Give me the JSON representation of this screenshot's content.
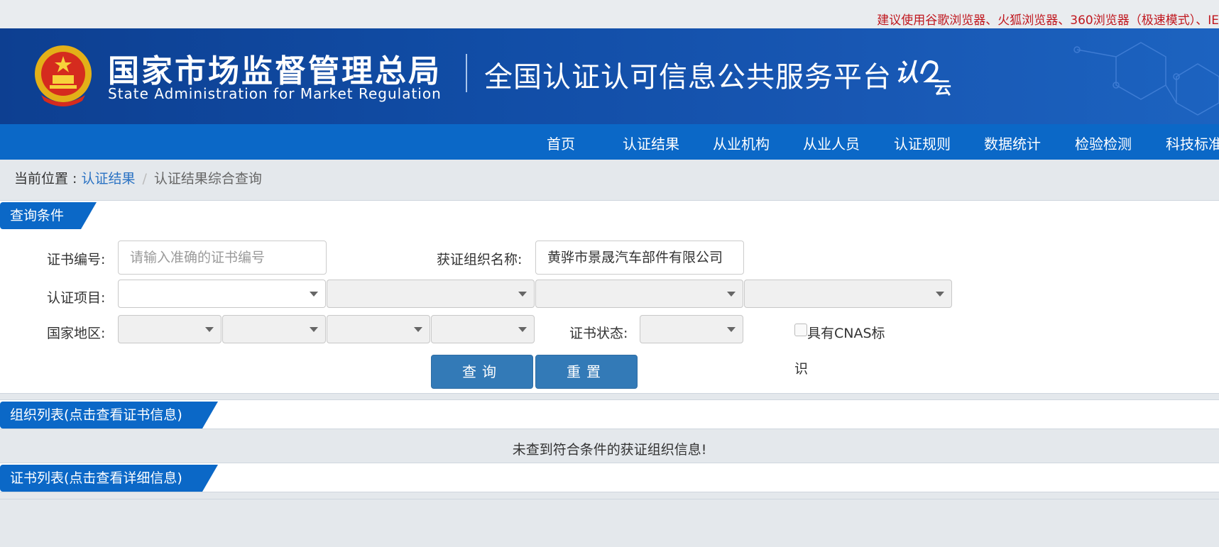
{
  "notice": "建议使用谷歌浏览器、火狐浏览器、360浏览器（极速模式）、IE",
  "header": {
    "org_name_cn": "国家市场监督管理总局",
    "org_name_en": "State Administration  for  Market Regulation",
    "platform_title": "全国认证认可信息公共服务平台",
    "logo_text": "认e云"
  },
  "nav": [
    "首页",
    "认证结果",
    "从业机构",
    "从业人员",
    "认证规则",
    "数据统计",
    "检验检测",
    "科技标准"
  ],
  "breadcrumb": {
    "prefix": "当前位置 : ",
    "parent": "认证结果",
    "separator": "/",
    "current": "认证结果综合查询"
  },
  "query": {
    "section_title": "查询条件",
    "cert_no_label": "证书编号:",
    "cert_no_placeholder": "请输入准确的证书编号",
    "org_name_label": "获证组织名称:",
    "org_name_value": "黄骅市景晟汽车部件有限公司",
    "project_label": "认证项目:",
    "region_label": "国家地区:",
    "status_label": "证书状态:",
    "cnas_label_line1": "具有CNAS标",
    "cnas_label_line2": "识",
    "search_button": "查询",
    "reset_button": "重置"
  },
  "org_list": {
    "title": "组织列表(点击查看证书信息)",
    "empty_message": "未查到符合条件的获证组织信息!"
  },
  "cert_list": {
    "title": "证书列表(点击查看详细信息)"
  },
  "colors": {
    "primary": "#0b68c7",
    "button": "#337ab7",
    "notice_red": "#c0181f",
    "link": "#2a72c3"
  }
}
